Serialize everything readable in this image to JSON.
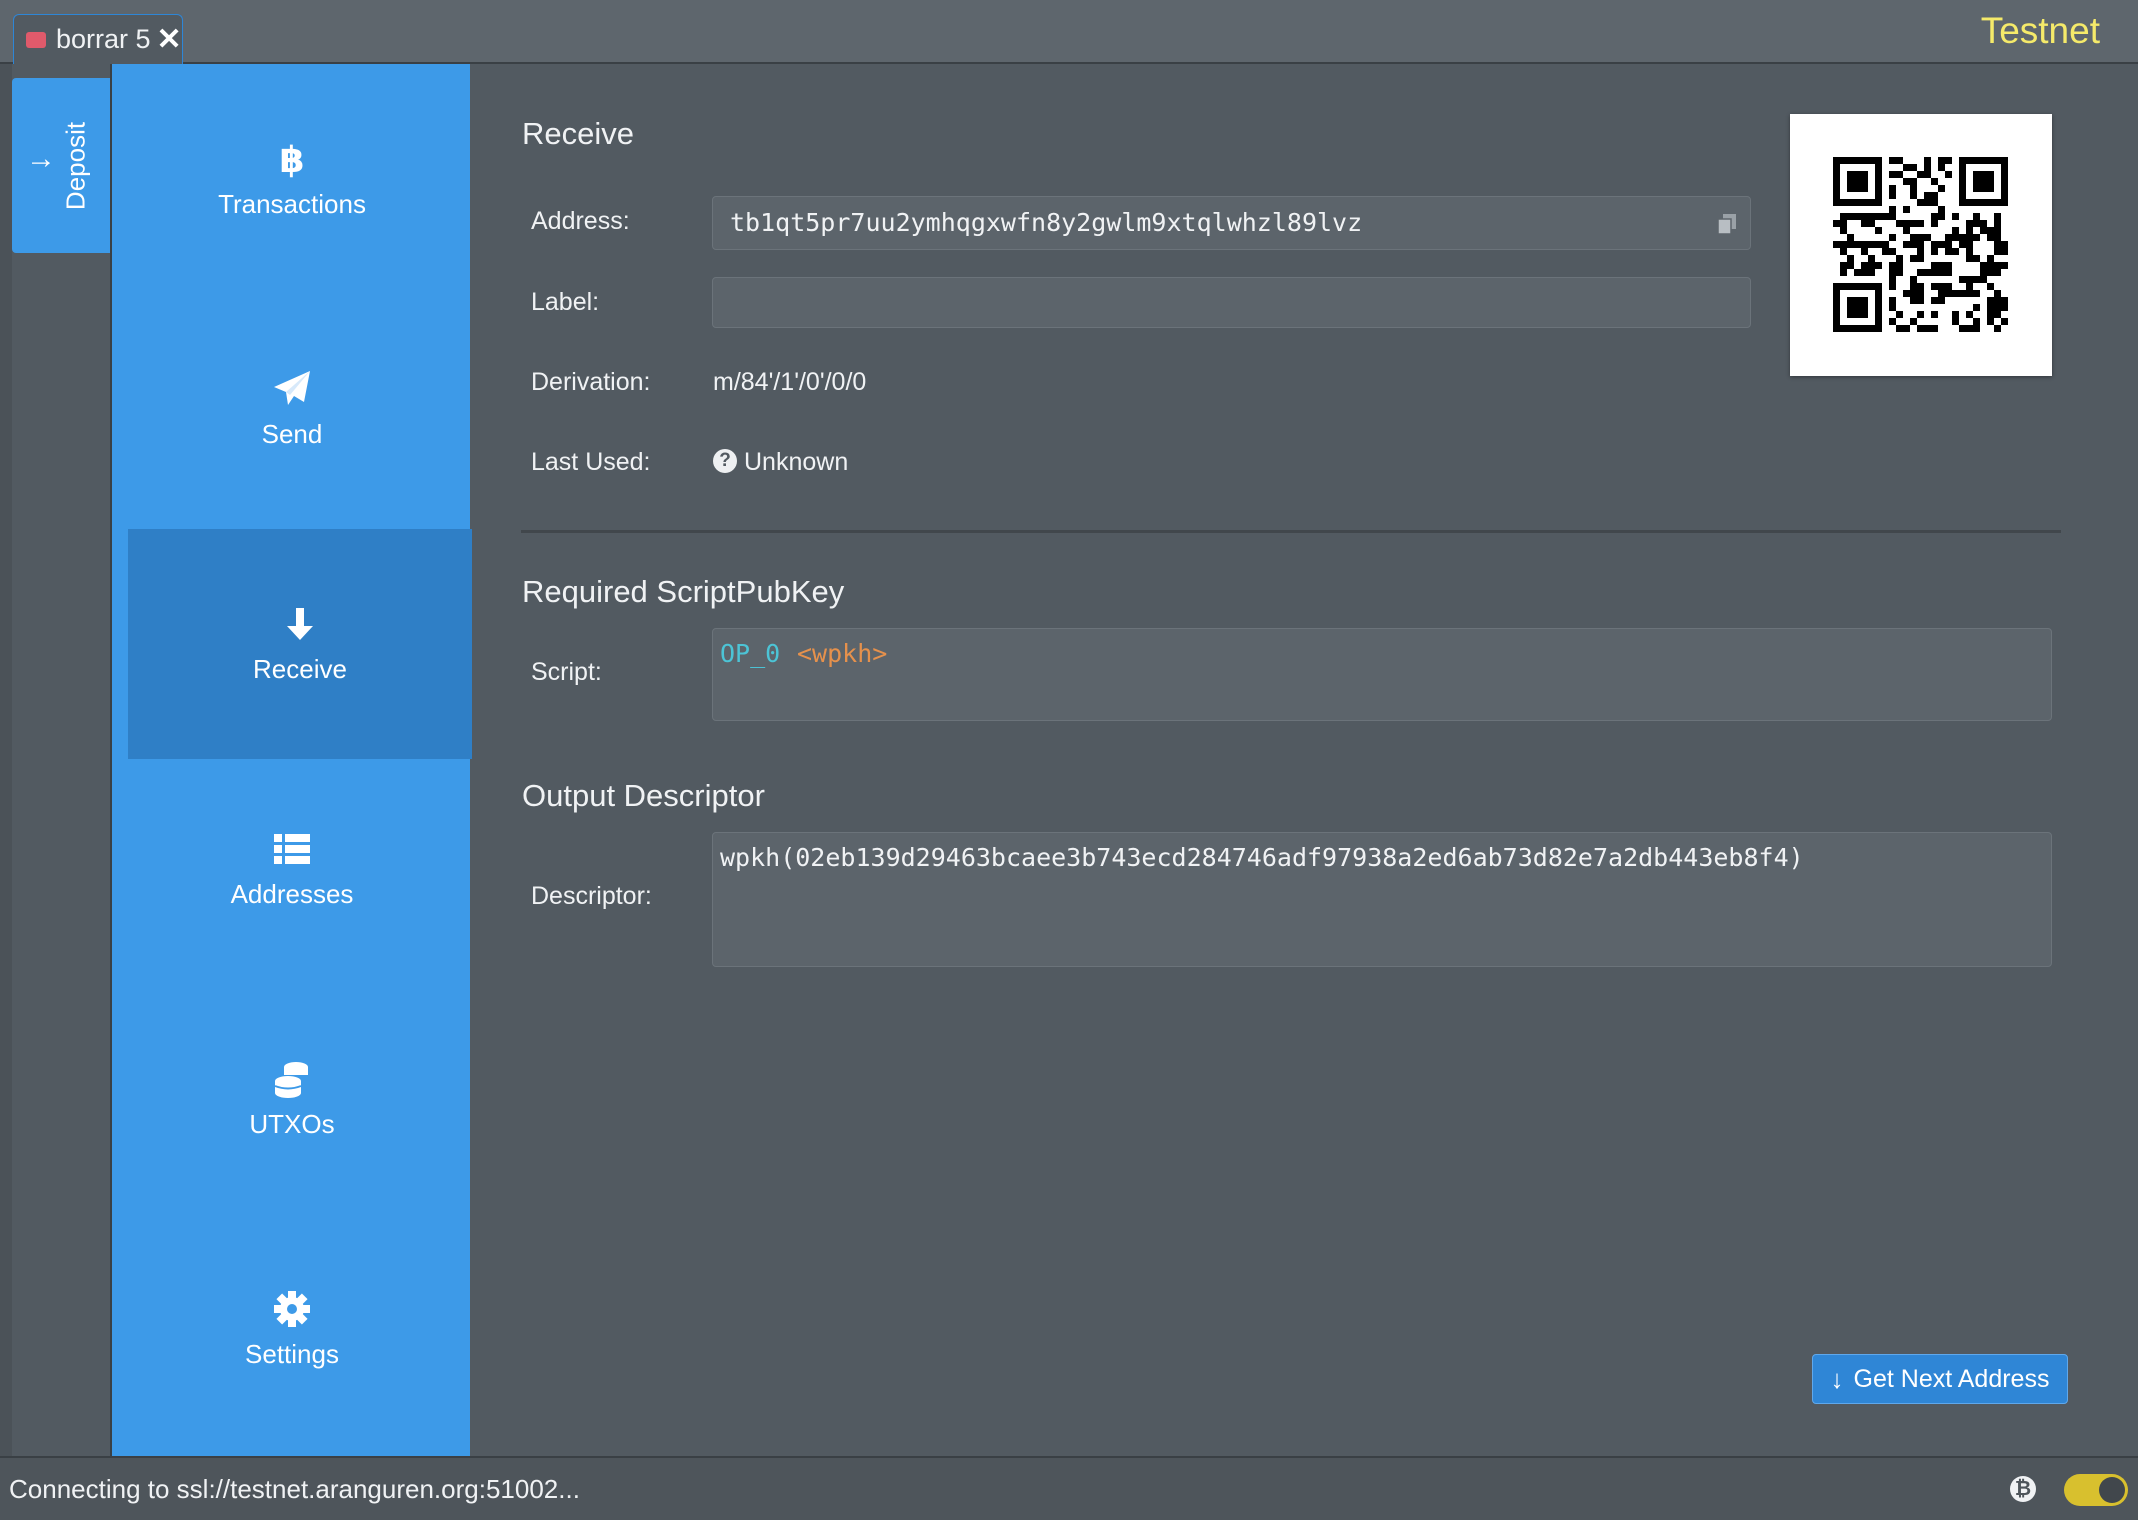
{
  "window": {
    "tab_label": "borrar 5",
    "network": "Testnet"
  },
  "deposit_tab": {
    "label": "Deposit"
  },
  "sidebar": {
    "items": [
      {
        "label": "Transactions",
        "icon": "bitcoin-icon"
      },
      {
        "label": "Send",
        "icon": "paper-plane-icon"
      },
      {
        "label": "Receive",
        "icon": "arrow-down-icon",
        "active": true
      },
      {
        "label": "Addresses",
        "icon": "list-icon"
      },
      {
        "label": "UTXOs",
        "icon": "coins-icon"
      },
      {
        "label": "Settings",
        "icon": "gear-icon"
      }
    ]
  },
  "receive": {
    "title": "Receive",
    "address_label": "Address:",
    "address_value": "tb1qt5pr7uu2ymhqgxwfn8y2gwlm9xtqlwhzl89lvz",
    "label_label": "Label:",
    "label_value": "",
    "derivation_label": "Derivation:",
    "derivation_value": "m/84'/1'/0'/0/0",
    "last_used_label": "Last Used:",
    "last_used_value": "Unknown"
  },
  "scriptpubkey": {
    "title": "Required ScriptPubKey",
    "script_label": "Script:",
    "op": "OP_0",
    "arg": "<wpkh>"
  },
  "descriptor": {
    "title": "Output Descriptor",
    "descriptor_label": "Descriptor:",
    "descriptor_value": "wpkh(02eb139d29463bcaee3b743ecd284746adf97938a2ed6ab73d82e7a2db443eb8f4)"
  },
  "actions": {
    "next_address_label": "Get Next Address"
  },
  "status": {
    "text": "Connecting to ssl://testnet.aranguren.org:51002..."
  },
  "colors": {
    "accent": "#3d9ae8",
    "network": "#f5ea6a",
    "op_code": "#4cc4d6",
    "script_arg": "#e6914c"
  }
}
